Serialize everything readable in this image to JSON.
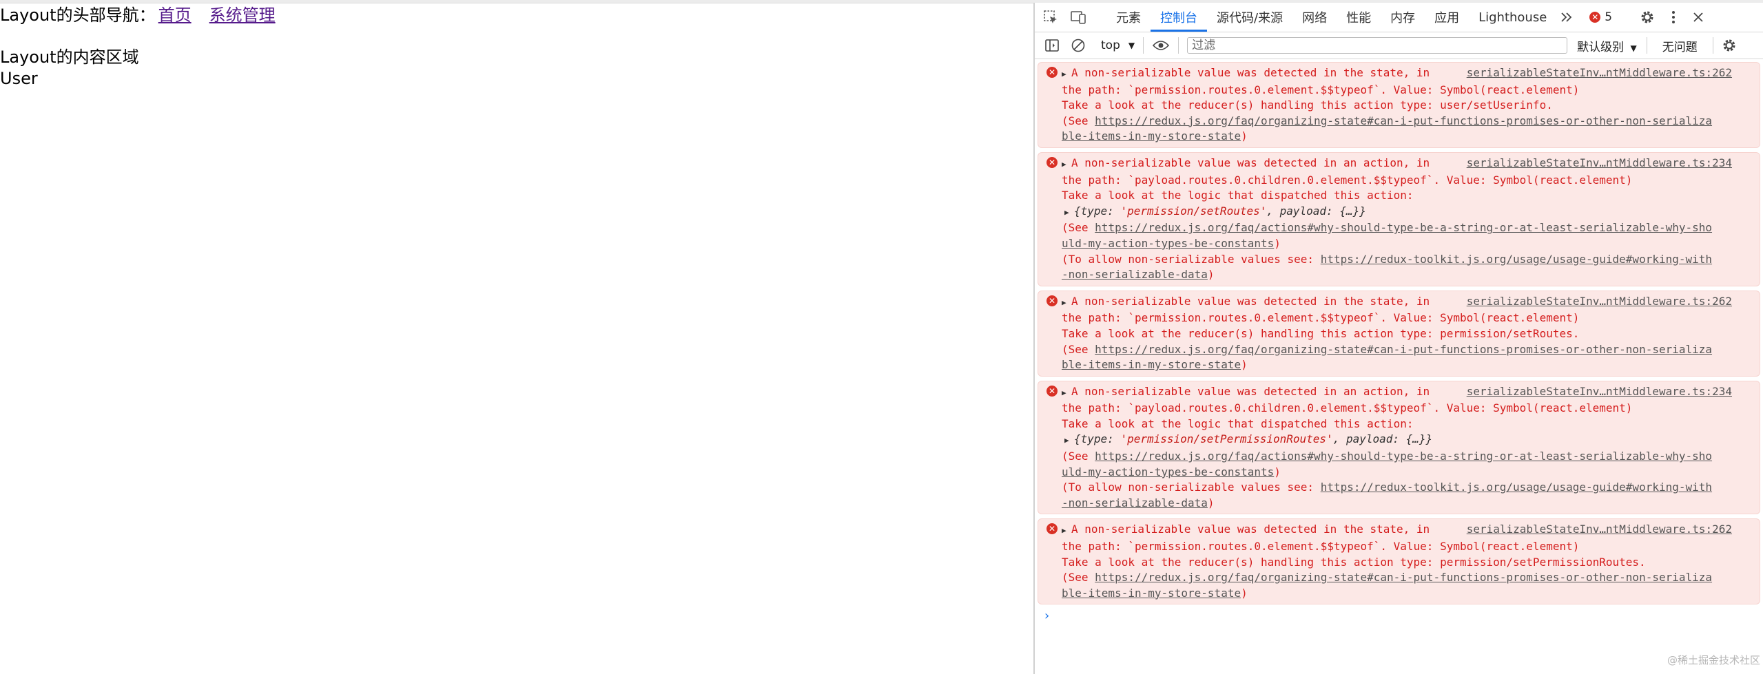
{
  "page": {
    "nav_prefix": "Layout的头部导航：",
    "nav_links": [
      "首页",
      "系统管理"
    ],
    "content_title": "Layout的内容区域",
    "content_user": "User"
  },
  "devtools": {
    "tabs": [
      "元素",
      "控制台",
      "源代码/来源",
      "网络",
      "性能",
      "内存",
      "应用",
      "Lighthouse"
    ],
    "active_tab": "控制台",
    "more_tabs_icon": "chevrons-right-icon",
    "error_count": "5",
    "toolbar": {
      "context": "top",
      "filter_placeholder": "过滤",
      "levels": "默认级别",
      "issues": "无问题"
    },
    "messages": [
      {
        "source": "serializableStateInv…ntMiddleware.ts:262",
        "l1": "A non-serializable value was detected in the state, in",
        "l2": "the path: `permission.routes.0.element.$$typeof`. Value: Symbol(react.element)",
        "l3": "Take a look at the reducer(s) handling this action type: user/setUserinfo.",
        "see_prefix": "(See ",
        "link1a": "https://redux.js.org/faq/organizing-state#can-i-put-functions-promises-or-other-non-serializa",
        "link1b": "ble-items-in-my-store-state",
        "close": ")"
      },
      {
        "source": "serializableStateInv…ntMiddleware.ts:234",
        "l1": "A non-serializable value was detected in an action, in",
        "l2": "the path: `payload.routes.0.children.0.element.$$typeof`. Value: Symbol(react.element)",
        "l3": "Take a look at the logic that dispatched this action:",
        "obj_open": "{type: ",
        "obj_type": "'permission/setRoutes'",
        "obj_rest": ", payload: {…}}",
        "see_prefix": "(See ",
        "link1a": "https://redux.js.org/faq/actions#why-should-type-be-a-string-or-at-least-serializable-why-sho",
        "link1b": "uld-my-action-types-be-constants",
        "allow_prefix": "(To allow non-serializable values see: ",
        "link2a": "https://redux-toolkit.js.org/usage/usage-guide#working-with",
        "link2b": "-non-serializable-data",
        "close": ")"
      },
      {
        "source": "serializableStateInv…ntMiddleware.ts:262",
        "l1": "A non-serializable value was detected in the state, in",
        "l2": "the path: `permission.routes.0.element.$$typeof`. Value: Symbol(react.element)",
        "l3": "Take a look at the reducer(s) handling this action type: permission/setRoutes.",
        "see_prefix": "(See ",
        "link1a": "https://redux.js.org/faq/organizing-state#can-i-put-functions-promises-or-other-non-serializa",
        "link1b": "ble-items-in-my-store-state",
        "close": ")"
      },
      {
        "source": "serializableStateInv…ntMiddleware.ts:234",
        "l1": "A non-serializable value was detected in an action, in",
        "l2": "the path: `payload.routes.0.children.0.element.$$typeof`. Value: Symbol(react.element)",
        "l3": "Take a look at the logic that dispatched this action:",
        "obj_open": "{type: ",
        "obj_type": "'permission/setPermissionRoutes'",
        "obj_rest": ", payload: {…}}",
        "see_prefix": "(See ",
        "link1a": "https://redux.js.org/faq/actions#why-should-type-be-a-string-or-at-least-serializable-why-sho",
        "link1b": "uld-my-action-types-be-constants",
        "allow_prefix": "(To allow non-serializable values see: ",
        "link2a": "https://redux-toolkit.js.org/usage/usage-guide#working-with",
        "link2b": "-non-serializable-data",
        "close": ")"
      },
      {
        "source": "serializableStateInv…ntMiddleware.ts:262",
        "l1": "A non-serializable value was detected in the state, in",
        "l2": "the path: `permission.routes.0.element.$$typeof`. Value: Symbol(react.element)",
        "l3": "Take a look at the reducer(s) handling this action type: permission/setPermissionRoutes.",
        "see_prefix": "(See ",
        "link1a": "https://redux.js.org/faq/organizing-state#can-i-put-functions-promises-or-other-non-serializa",
        "link1b": "ble-items-in-my-store-state",
        "close": ")"
      }
    ],
    "prompt": "›"
  },
  "watermark": "@稀土掘金技术社区",
  "colors": {
    "accent": "#1a73e8",
    "error": "#d93025",
    "error_bg": "#fce8e6"
  }
}
